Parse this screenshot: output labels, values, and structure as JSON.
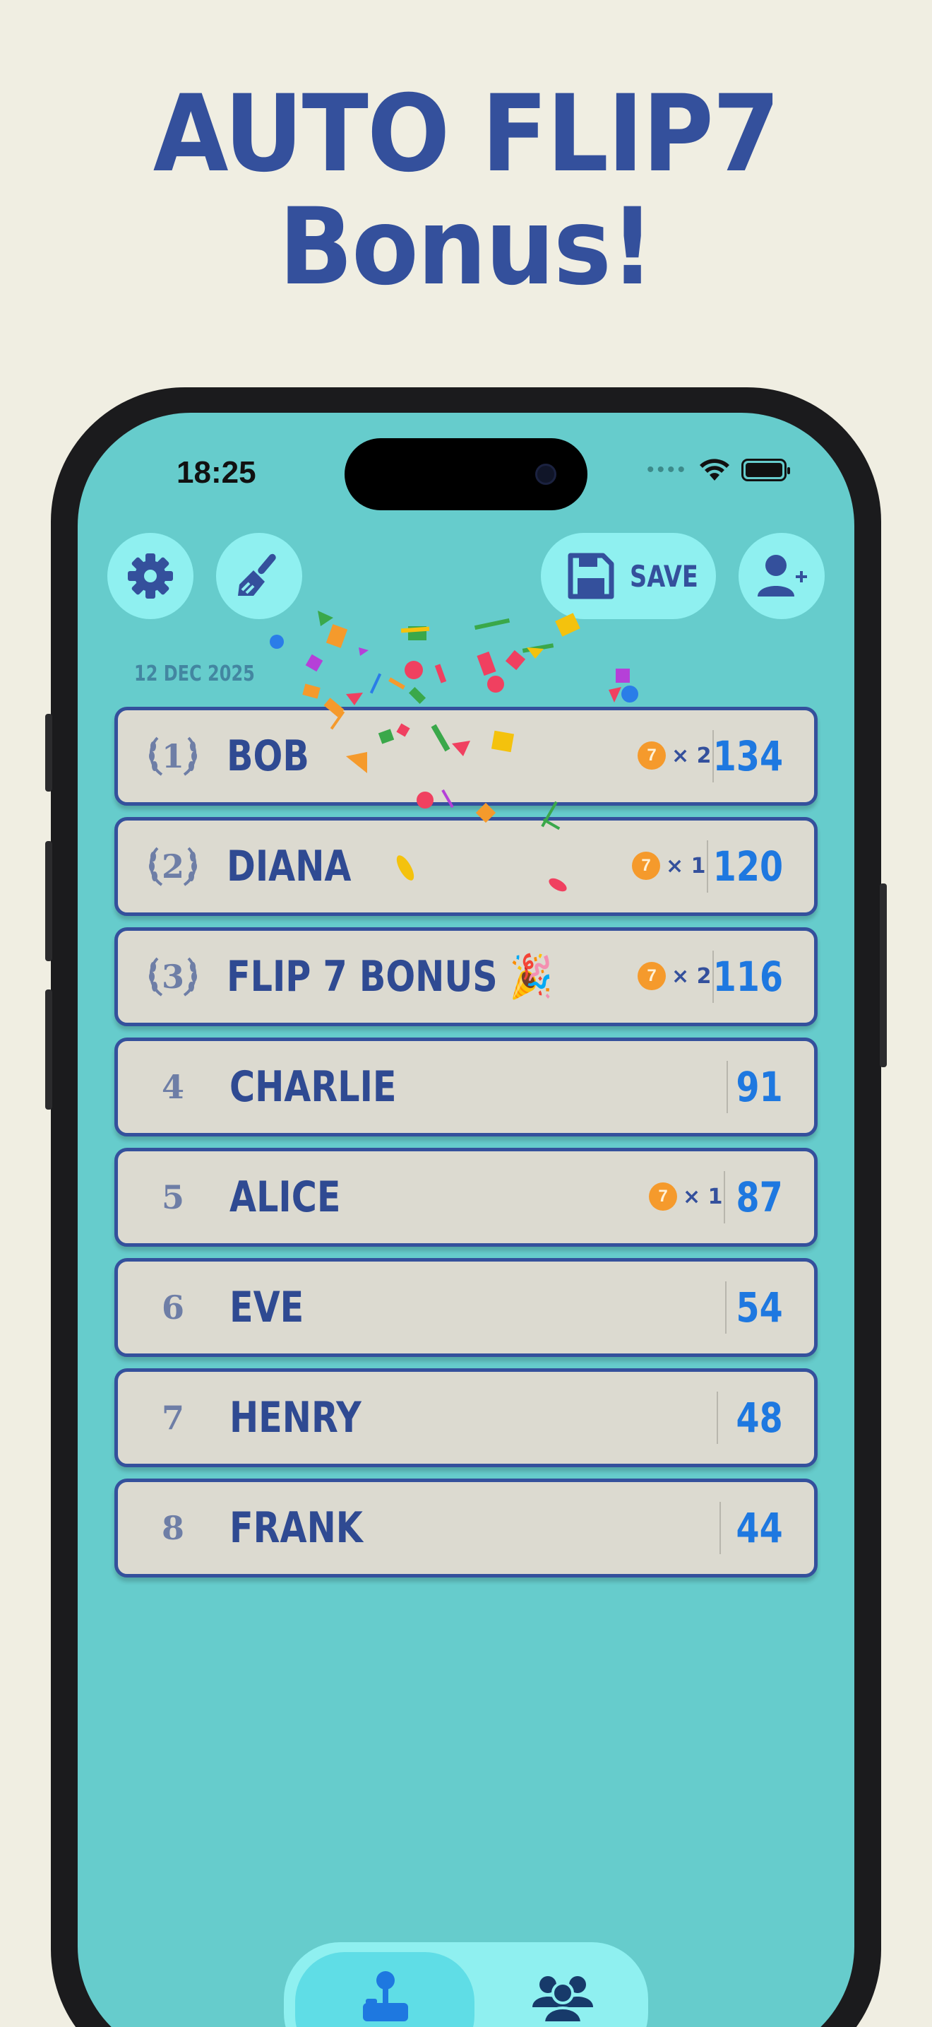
{
  "headline": {
    "line1": "AUTO FLIP7",
    "line2": "Bonus!"
  },
  "status_bar": {
    "time": "18:25"
  },
  "toolbar": {
    "save_label": "SAVE"
  },
  "date": "12 DEC 2025",
  "players": [
    {
      "rank": "1",
      "name": "BOB",
      "bonus": "7",
      "multiplier": "× 2",
      "score": "134",
      "laurel": true
    },
    {
      "rank": "2",
      "name": "DIANA",
      "bonus": "7",
      "multiplier": "× 1",
      "score": "120",
      "laurel": true
    },
    {
      "rank": "3",
      "name": "FLIP 7 BONUS 🎉",
      "bonus": "7",
      "multiplier": "× 2",
      "score": "116",
      "laurel": true
    },
    {
      "rank": "4",
      "name": "CHARLIE",
      "score": "91"
    },
    {
      "rank": "5",
      "name": "ALICE",
      "bonus": "7",
      "multiplier": "× 1",
      "score": "87"
    },
    {
      "rank": "6",
      "name": "EVE",
      "score": "54"
    },
    {
      "rank": "7",
      "name": "HENRY",
      "score": "48"
    },
    {
      "rank": "8",
      "name": "FRANK",
      "score": "44"
    }
  ],
  "colors": {
    "brand": "#34509c",
    "screen": "#66cccc",
    "button": "#8ff0f0",
    "score": "#1e78e0",
    "coin": "#f59a2c"
  },
  "icons": [
    "gear-icon",
    "brush-icon",
    "floppy-disk-icon",
    "add-user-icon",
    "joystick-icon",
    "people-icon"
  ]
}
